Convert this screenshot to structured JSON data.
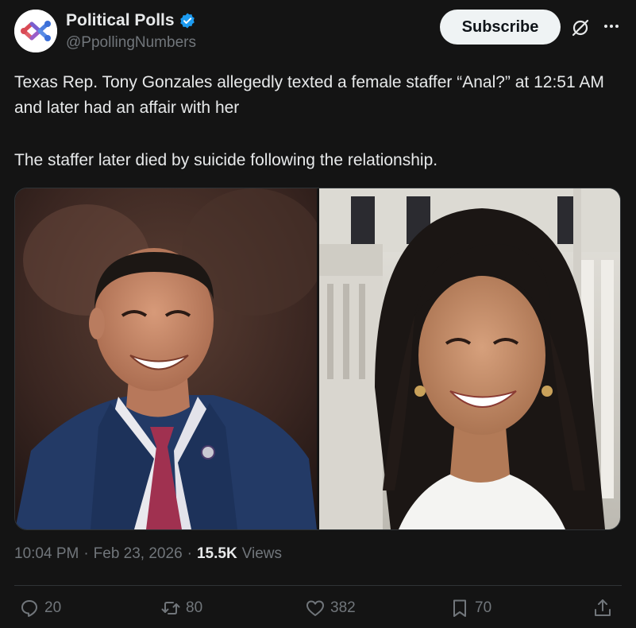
{
  "author": {
    "display_name": "Political Polls",
    "handle": "@PpollingNumbers",
    "verified": true
  },
  "header": {
    "subscribe_label": "Subscribe",
    "grok_icon": "grok-icon",
    "more_icon": "more-icon"
  },
  "tweet": {
    "paragraph_1": "Texas Rep. Tony Gonzales allegedly texted a female staffer “Anal?” at 12:51 AM and later had an affair with her",
    "paragraph_2": "The staffer later died by suicide following the relationship."
  },
  "media": {
    "photo_1": "man-in-suit-photo",
    "photo_2": "woman-smiling-photo"
  },
  "meta": {
    "time": "10:04 PM",
    "separator": "·",
    "date": "Feb 23, 2026",
    "views_count": "15.5K",
    "views_label": "Views"
  },
  "actions": {
    "replies": "20",
    "reposts": "80",
    "likes": "382",
    "bookmarks": "70"
  },
  "colors": {
    "background": "#141414",
    "text": "#e7e9ea",
    "muted": "#71767b",
    "verified": "#1d9bf0",
    "subscribe_bg": "#eff3f4"
  }
}
